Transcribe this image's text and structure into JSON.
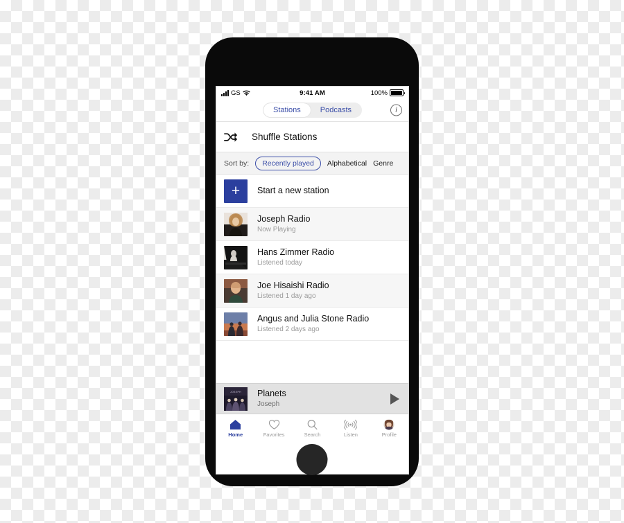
{
  "statusbar": {
    "carrier": "GS",
    "time": "9:41 AM",
    "battery_pct": "100%",
    "signal_icon": "signal-bars-icon",
    "wifi_icon": "wifi-icon",
    "battery_icon": "battery-icon"
  },
  "navbar": {
    "segments": [
      {
        "label": "Stations",
        "selected": true
      },
      {
        "label": "Podcasts",
        "selected": false
      }
    ],
    "info_label": "i",
    "info_icon": "info-circle-icon"
  },
  "shuffle": {
    "label": "Shuffle Stations",
    "icon": "shuffle-icon"
  },
  "sort": {
    "label": "Sort by:",
    "options": [
      {
        "label": "Recently played",
        "selected": true
      },
      {
        "label": "Alphabetical",
        "selected": false
      },
      {
        "label": "Genre",
        "selected": false
      }
    ]
  },
  "list": {
    "new_station": {
      "title": "Start a new station",
      "icon": "plus-icon"
    },
    "stations": [
      {
        "title": "Joseph Radio",
        "subtitle": "Now Playing",
        "thumb": "joseph-artwork"
      },
      {
        "title": "Hans Zimmer Radio",
        "subtitle": "Listened today",
        "thumb": "hans-zimmer-artwork"
      },
      {
        "title": "Joe Hisaishi Radio",
        "subtitle": "Listened 1 day ago",
        "thumb": "joe-hisaishi-artwork"
      },
      {
        "title": "Angus and Julia Stone Radio",
        "subtitle": "Listened 2 days ago",
        "thumb": "angus-julia-stone-artwork"
      }
    ]
  },
  "now_playing": {
    "title": "Planets",
    "artist": "Joseph",
    "artwork_caption": "JOSEPH",
    "play_icon": "play-icon"
  },
  "tabbar": {
    "tabs": [
      {
        "label": "Home",
        "icon": "home-icon",
        "active": true
      },
      {
        "label": "Favorites",
        "icon": "heart-icon",
        "active": false
      },
      {
        "label": "Search",
        "icon": "search-icon",
        "active": false
      },
      {
        "label": "Listen",
        "icon": "broadcast-icon",
        "active": false
      },
      {
        "label": "Profile",
        "icon": "avatar-icon",
        "active": false
      }
    ]
  },
  "colors": {
    "accent_blue": "#2b3f9e",
    "link_blue": "#3b4ea8",
    "muted_gray": "#9b9b9b",
    "bar_gray": "#e2e2e2"
  }
}
